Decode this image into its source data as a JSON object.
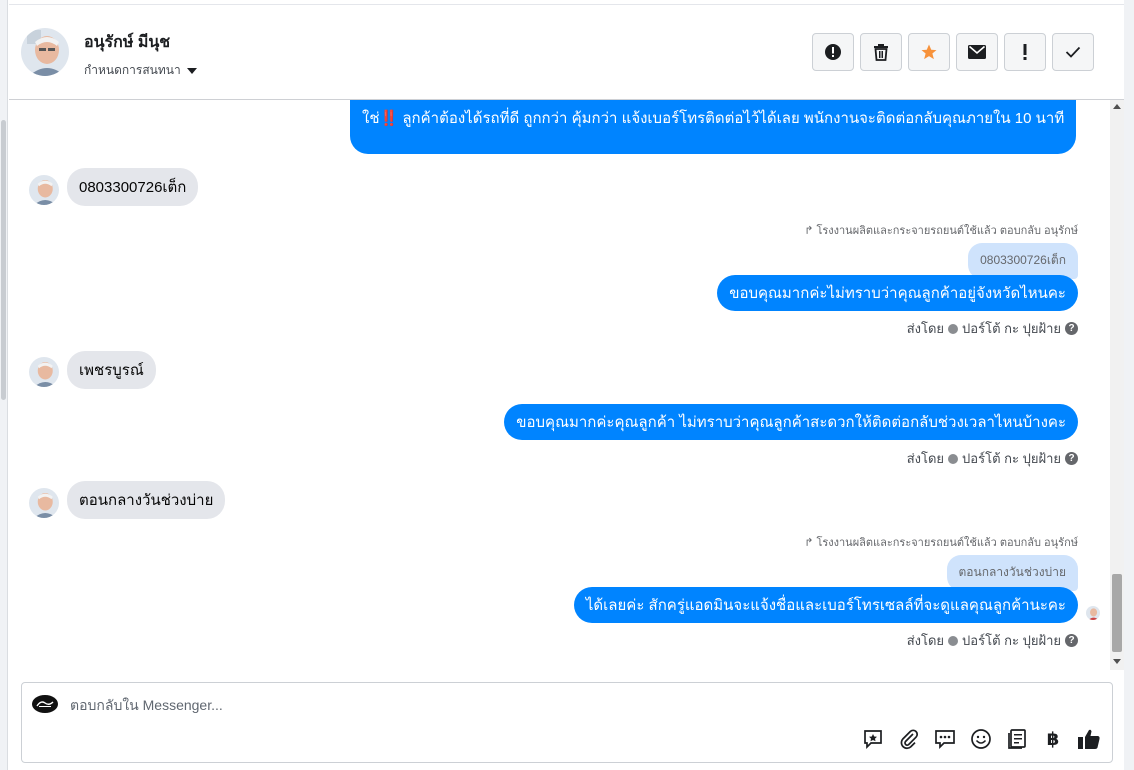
{
  "header": {
    "name": "อนุรักษ์ มีนุช",
    "status": "กำหนดการสนทนา",
    "actions": [
      {
        "name": "report-spam-button",
        "icon": "alert-circle-icon"
      },
      {
        "name": "delete-button",
        "icon": "trash-icon"
      },
      {
        "name": "star-button",
        "icon": "star-icon"
      },
      {
        "name": "mark-unread-button",
        "icon": "envelope-icon"
      },
      {
        "name": "follow-up-button",
        "icon": "exclamation-icon"
      },
      {
        "name": "mark-done-button",
        "icon": "check-icon"
      }
    ]
  },
  "messages": {
    "m1": {
      "text": "ใช่‼️ ลูกค้าต้องได้รถที่ดี ถูกกว่า คุ้มกว่า แจ้งเบอร์โทรติดต่อไว้ได้เลย พนักงานจะติดต่อกลับคุณภายใน 10 นาที"
    },
    "m2": {
      "text": "0803300726เต็ก"
    },
    "m3": {
      "reply_meta": "โรงงานผลิตและกระจายรถยนต์ใช้แล้ว ตอบกลับ อนุรักษ์",
      "quote": "0803300726เต็ก",
      "text": "ขอบคุณมากค่ะไม่ทราบว่าคุณลูกค้าอยู่จังหวัดไหนคะ",
      "sent_by_label": "ส่งโดย",
      "sender": "ปอร์โต้ กะ ปุยฝ้าย"
    },
    "m4": {
      "text": "เพชรบูรณ์"
    },
    "m5": {
      "text": "ขอบคุณมากค่ะคุณลูกค้า ไม่ทราบว่าคุณลูกค้าสะดวกให้ติดต่อกลับช่วงเวลาไหนบ้างคะ",
      "sent_by_label": "ส่งโดย",
      "sender": "ปอร์โต้ กะ ปุยฝ้าย"
    },
    "m6": {
      "text": "ตอนกลางวันช่วงบ่าย"
    },
    "m7": {
      "reply_meta": "โรงงานผลิตและกระจายรถยนต์ใช้แล้ว ตอบกลับ อนุรักษ์",
      "quote": "ตอนกลางวันช่วงบ่าย",
      "text": "ได้เลยค่ะ สักครู่แอดมินจะแจ้งชื่อและเบอร์โทรเซลล์ที่จะดูแลคุณลูกค้านะคะ",
      "sent_by_label": "ส่งโดย",
      "sender": "ปอร์โต้ กะ ปุยฝ้าย"
    }
  },
  "composer": {
    "placeholder": "ตอบกลับใน Messenger...",
    "currency_symbol": "฿",
    "tools": [
      "saved-reply-icon",
      "attachment-icon",
      "chat-bubbles-icon",
      "emoji-icon",
      "document-icon",
      "baht-icon",
      "like-icon"
    ]
  },
  "colors": {
    "outgoing_bubble": "#0084ff",
    "incoming_bubble": "#e4e6eb",
    "quote_bubble": "#cfe3fc",
    "star": "#f7923b"
  }
}
